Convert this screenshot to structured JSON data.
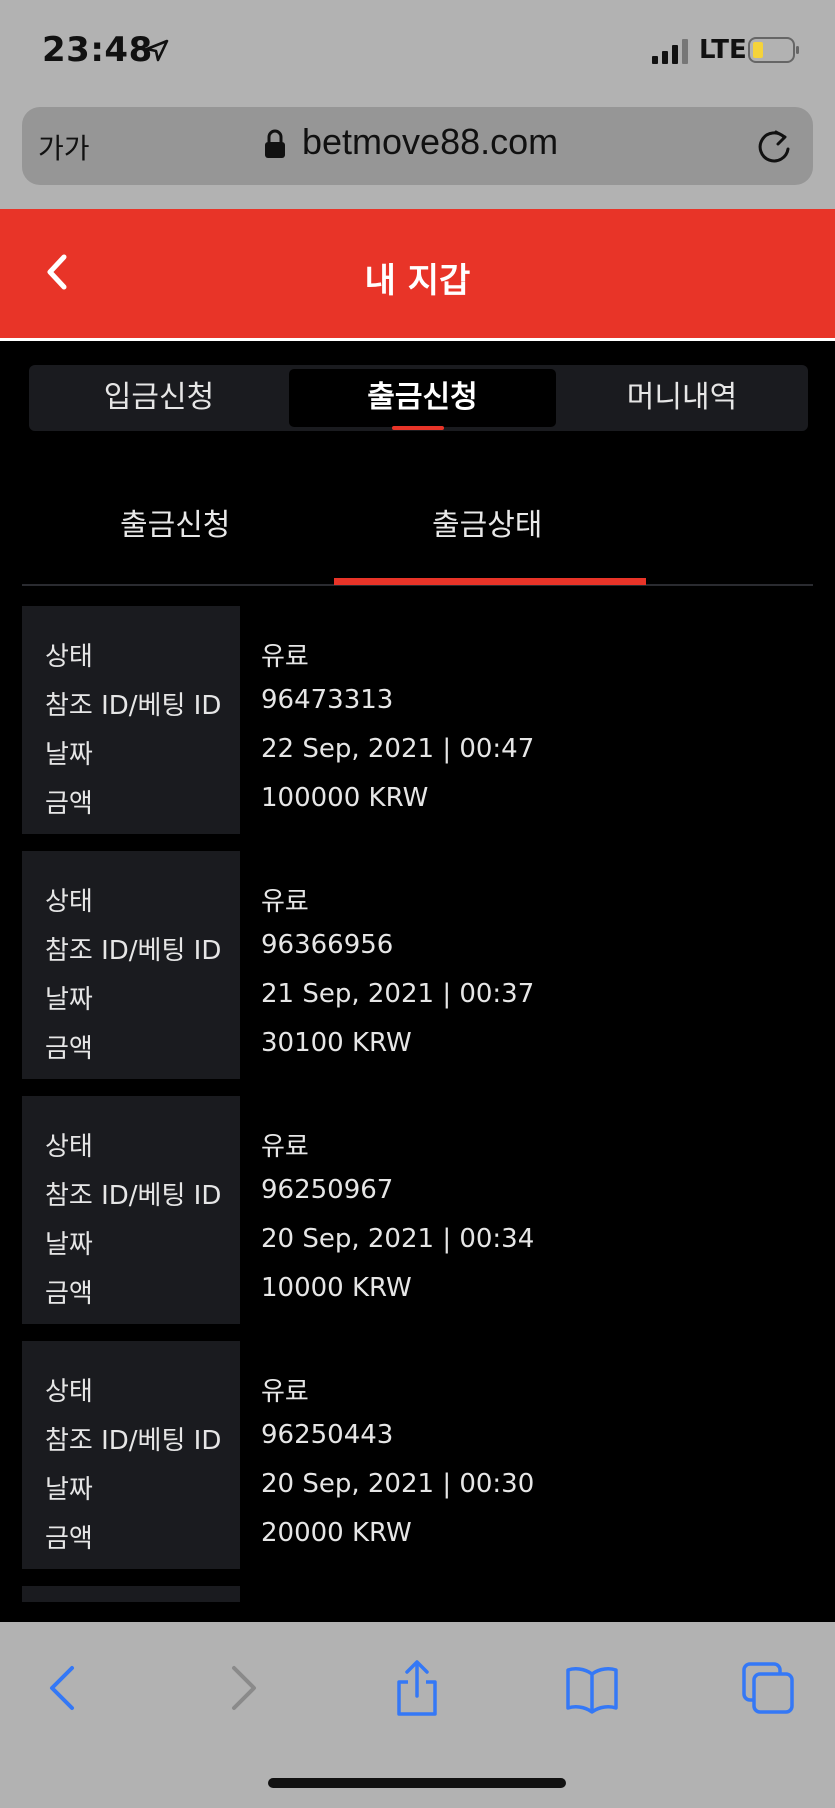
{
  "status_bar": {
    "time": "23:48",
    "network": "LTE"
  },
  "browser": {
    "text_size_label": "가가",
    "url": "betmove88.com"
  },
  "header": {
    "title": "내 지갑"
  },
  "tabs": [
    {
      "label": "입금신청",
      "active": false
    },
    {
      "label": "출금신청",
      "active": true
    },
    {
      "label": "머니내역",
      "active": false
    }
  ],
  "subtabs": [
    {
      "label": "출금신청",
      "active": false
    },
    {
      "label": "출금상태",
      "active": true
    }
  ],
  "labels": {
    "status": "상태",
    "ref_id": "참조 ID/베팅 ID",
    "date": "날짜",
    "amount": "금액"
  },
  "records": [
    {
      "status": "유료",
      "ref_id": "96473313",
      "date": "22 Sep, 2021 | 00:47",
      "amount": "100000 KRW"
    },
    {
      "status": "유료",
      "ref_id": "96366956",
      "date": "21 Sep, 2021 | 00:37",
      "amount": "30100 KRW"
    },
    {
      "status": "유료",
      "ref_id": "96250967",
      "date": "20 Sep, 2021 | 00:34",
      "amount": "10000 KRW"
    },
    {
      "status": "유료",
      "ref_id": "96250443",
      "date": "20 Sep, 2021 | 00:30",
      "amount": "20000 KRW"
    }
  ],
  "colors": {
    "accent": "#e83428",
    "panel": "#1a1b1f",
    "ios_blue": "#3478f6"
  },
  "toolbar_icons": [
    "back-icon",
    "forward-icon",
    "share-icon",
    "bookmarks-icon",
    "tabs-icon"
  ]
}
